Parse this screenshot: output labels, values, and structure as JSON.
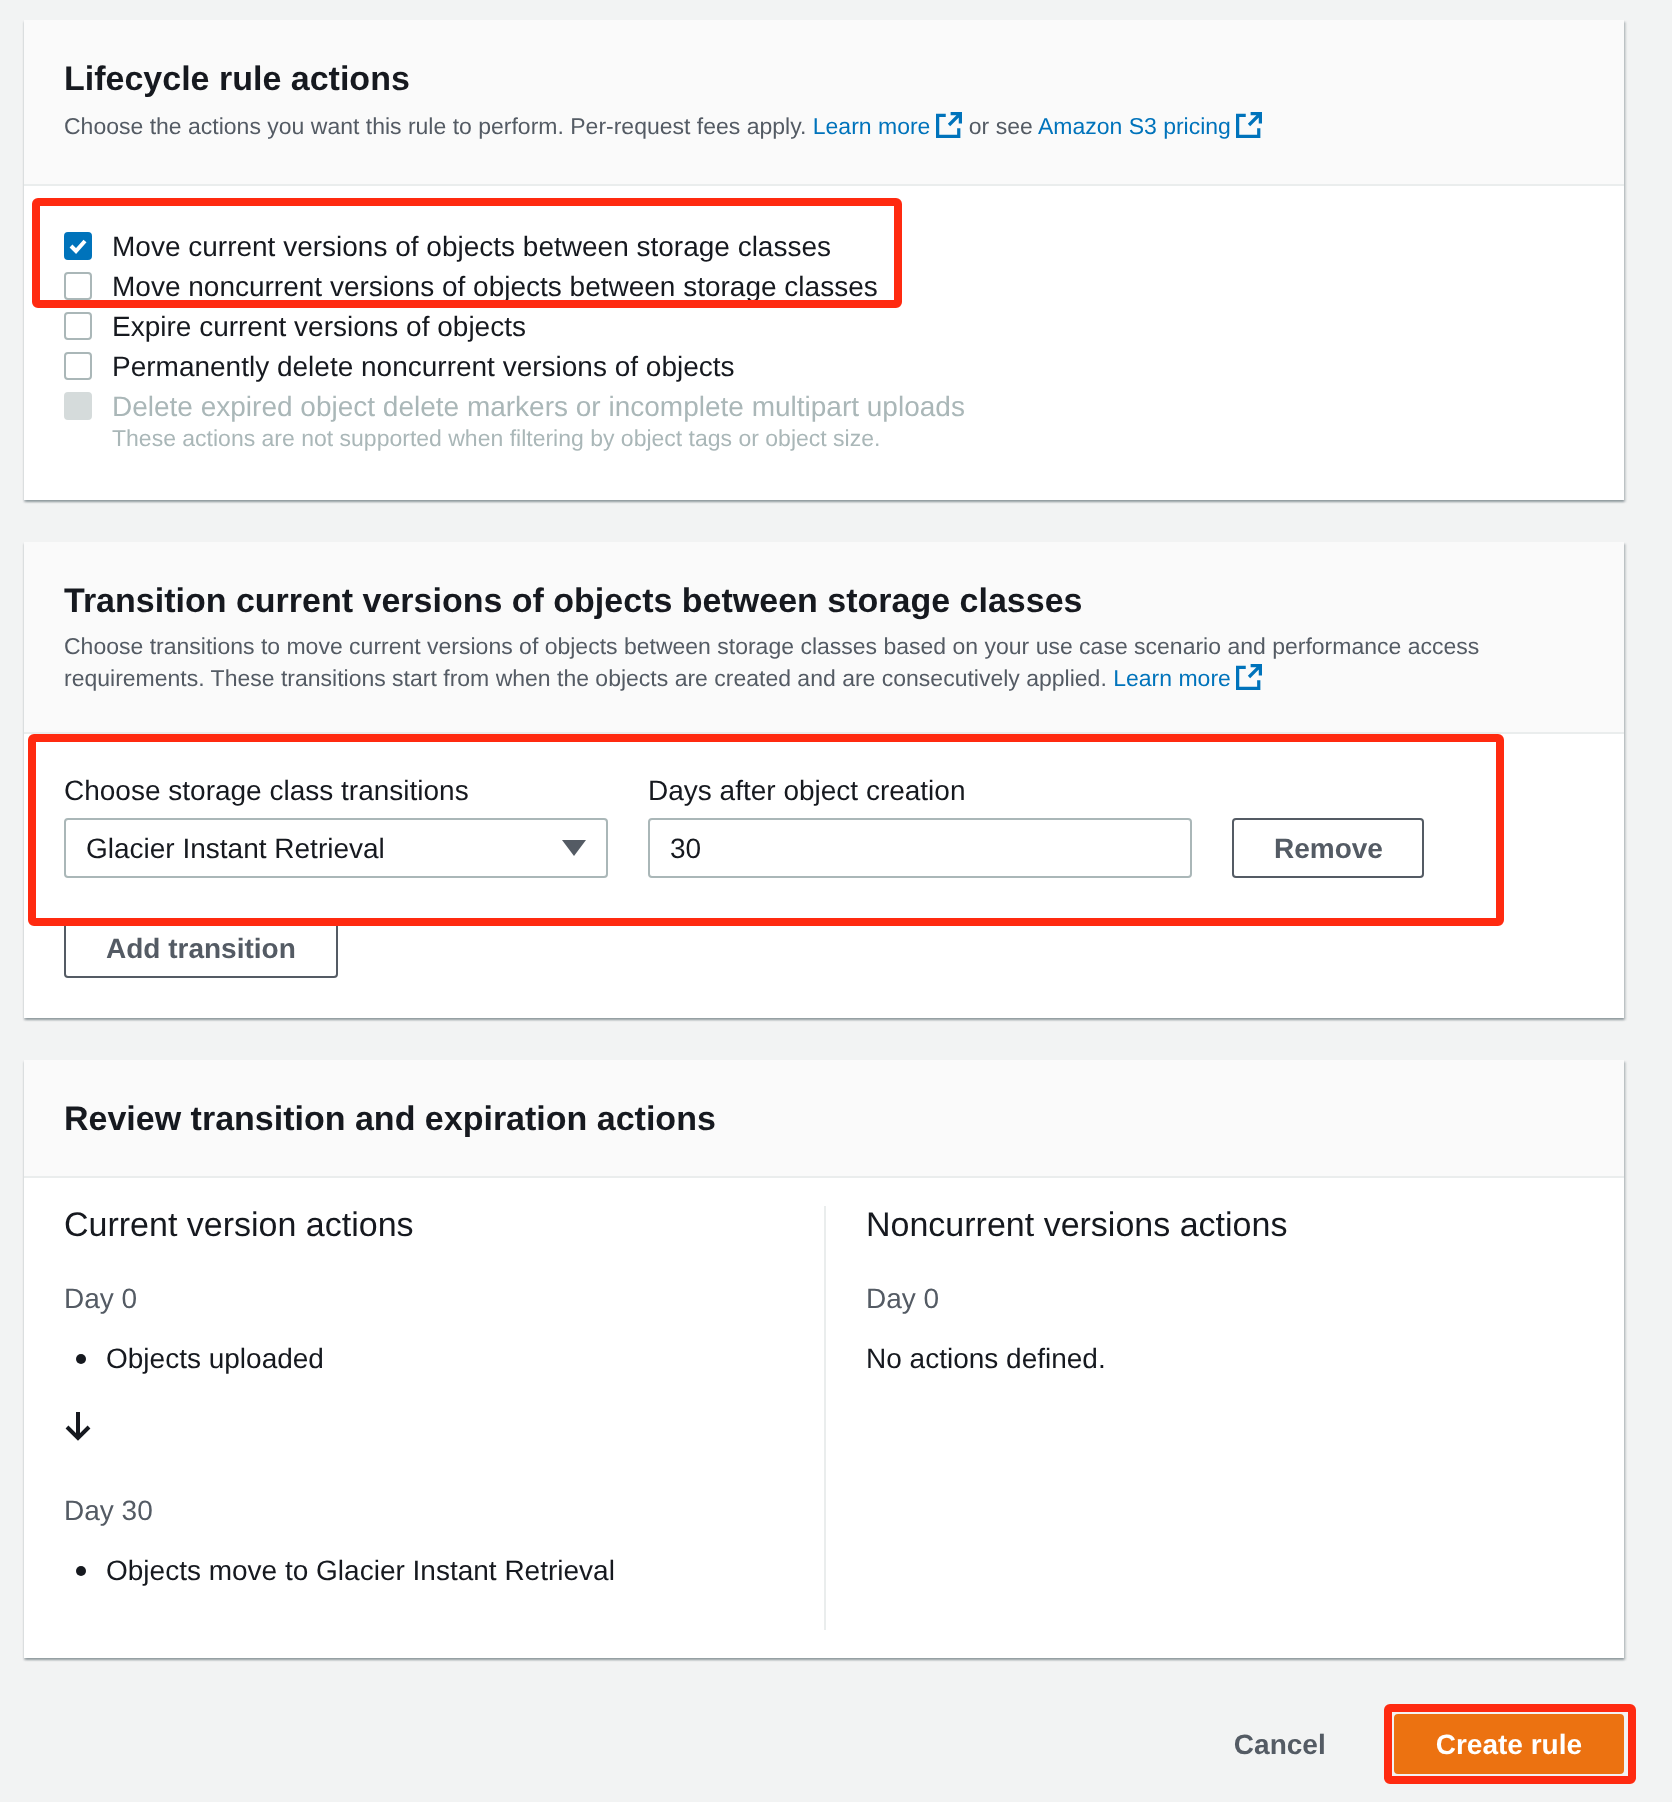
{
  "actions_panel": {
    "title": "Lifecycle rule actions",
    "description": "Choose the actions you want this rule to perform. Per-request fees apply.",
    "links": [
      {
        "label": "Learn more"
      },
      {
        "label": "Amazon S3 pricing"
      }
    ],
    "link_joiner": "or see",
    "checkboxes": [
      {
        "label": "Move current versions of objects between storage classes",
        "checked": true,
        "disabled": false,
        "highlighted": true
      },
      {
        "label": "Move noncurrent versions of objects between storage classes",
        "checked": false,
        "disabled": false,
        "highlighted": true
      },
      {
        "label": "Expire current versions of objects",
        "checked": false,
        "disabled": false,
        "highlighted": false
      },
      {
        "label": "Permanently delete noncurrent versions of objects",
        "checked": false,
        "disabled": false,
        "highlighted": false
      },
      {
        "label": "Delete expired object delete markers or incomplete multipart uploads",
        "checked": false,
        "disabled": true,
        "highlighted": false,
        "hint": "These actions are not supported when filtering by object tags or object size."
      }
    ]
  },
  "transition_panel": {
    "title": "Transition current versions of objects between storage classes",
    "description": "Choose transitions to move current versions of objects between storage classes based on your use case scenario and performance access requirements. These transitions start from when the objects are created and are consecutively applied.",
    "link": "Learn more",
    "transitions": [
      {
        "class_label": "Choose storage class transitions",
        "class_value": "Glacier Instant Retrieval",
        "days_label": "Days after object creation",
        "days_value": "30",
        "remove_button": "Remove",
        "highlighted": true
      }
    ],
    "add_button": "Add transition"
  },
  "review_panel": {
    "title": "Review transition and expiration actions",
    "columns": [
      {
        "title": "Current version actions",
        "steps": [
          {
            "day": "Day 0",
            "items": [
              "Objects uploaded"
            ]
          },
          {
            "day": "Day 30",
            "items": [
              "Objects move to Glacier Instant Retrieval"
            ]
          }
        ]
      },
      {
        "title": "Noncurrent versions actions",
        "steps": [
          {
            "day": "Day 0",
            "note": "No actions defined."
          }
        ]
      }
    ]
  },
  "footer": {
    "cancel": "Cancel",
    "create": {
      "label": "Create rule",
      "highlighted": true
    }
  }
}
